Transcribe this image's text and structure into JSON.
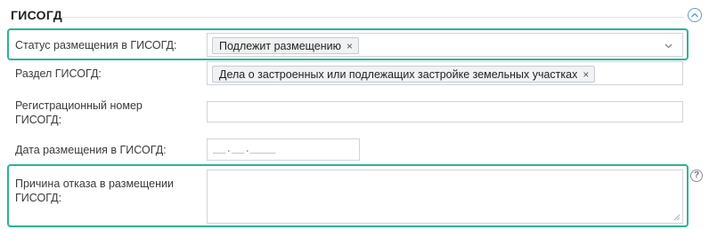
{
  "section": {
    "title": "ГИСОГД",
    "collapse_icon": "chevron-up-circle-icon"
  },
  "fields": {
    "status": {
      "label": "Статус размещения в ГИСОГД:",
      "tag": "Подлежит размещению",
      "remove_glyph": "×",
      "dropdown_icon": "chevron-down-icon"
    },
    "razdel": {
      "label": "Раздел ГИСОГД:",
      "tag": "Дела о застроенных или подлежащих застройке земельных участках",
      "remove_glyph": "×"
    },
    "reg_number": {
      "label_line1": "Регистрационный номер",
      "label_line2": "ГИСОГД:",
      "value": ""
    },
    "date": {
      "label": "Дата размещения в ГИСОГД:",
      "mask": "__.__.____"
    },
    "reason": {
      "label_line1": "Причина отказа в размещении",
      "label_line2": "ГИСОГД:",
      "value": "",
      "help_glyph": "?"
    }
  },
  "colors": {
    "highlight": "#2bb398",
    "accent": "#5b9bd5",
    "border": "#cfd4d9"
  }
}
